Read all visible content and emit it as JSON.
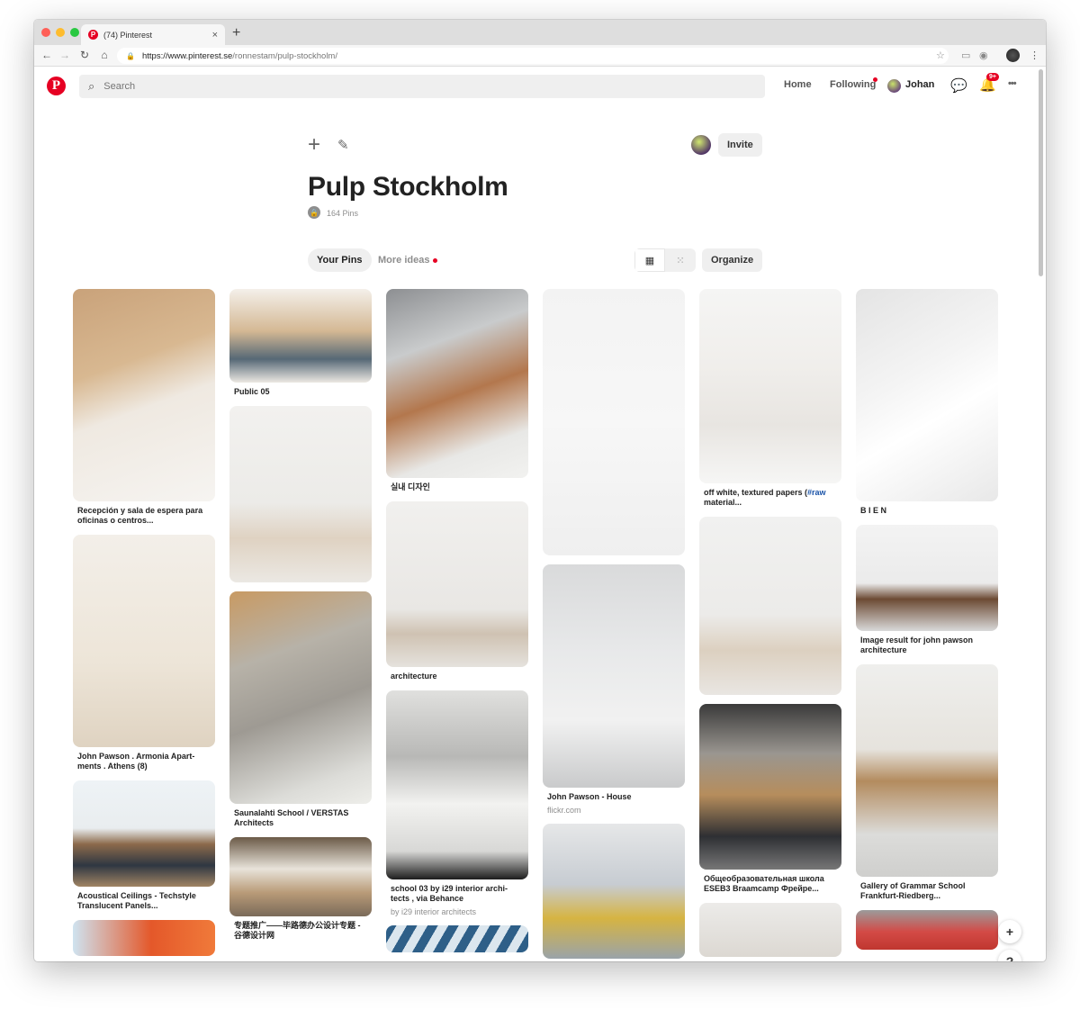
{
  "browser": {
    "tab_title": "(74) Pinterest",
    "tab_close": "×",
    "new_tab": "+",
    "url_base": "https://www.pinterest.se",
    "url_path": "/ronnestam/pulp-stockholm/",
    "back": "←",
    "forward": "→",
    "reload": "↻",
    "home": "⌂",
    "star": "☆",
    "menu": "⋮",
    "traffic_colors": [
      "#ff5f57",
      "#febc2e",
      "#28c840"
    ]
  },
  "header": {
    "logo": "P",
    "search_placeholder": "Search",
    "nav": {
      "home": "Home",
      "following": "Following",
      "user": "Johan"
    },
    "notif_badge": "9+",
    "more": "•••"
  },
  "board": {
    "title": "Pulp Stockholm",
    "pin_count": "164 Pins",
    "invite": "Invite",
    "tabs": {
      "your_pins": "Your Pins",
      "more_ideas": "More ideas"
    },
    "organize": "Organize"
  },
  "columns": [
    [
      {
        "caption": "Recepción y sala de espera para oficinas o centros...",
        "source": "",
        "h": 236,
        "bg": "linear-gradient(160deg,#c9a27a 0%,#d8b891 35%,#efe9e1 55%,#f6f4f1 100%)"
      },
      {
        "caption": "John Pawson . Armonia Apart-ments . Athens (8)",
        "source": "",
        "h": 236,
        "bg": "linear-gradient(180deg,#f3efe9 0%,#ede5d8 60%,#dfd3c1 100%)"
      },
      {
        "caption": "Acoustical Ceilings - Techstyle Translucent Panels...",
        "source": "",
        "h": 118,
        "bg": "linear-gradient(180deg,#eef3f6 0%,#e9edef 45%,#8c6a4b 60%,#2f3742 80%,#a08463 100%)"
      },
      {
        "caption": "",
        "source": "",
        "h": 40,
        "bg": "linear-gradient(90deg,#cfe3f0 0%,#e4582a 55%,#f07a3a 100%)"
      }
    ],
    [
      {
        "caption": "Public 05",
        "source": "",
        "h": 104,
        "bg": "linear-gradient(180deg,#f4f0ea 0%,#d4b894 45%,#566876 75%,#ece8e2 100%)"
      },
      {
        "caption": "",
        "source": "",
        "h": 196,
        "bg": "linear-gradient(180deg,#f2f1ef 0%,#ecebe8 55%,#dfd2c2 75%,#ebe8e3 100%)"
      },
      {
        "caption": "Saunalahti School / VERSTAS Architects",
        "source": "",
        "h": 236,
        "bg": "linear-gradient(160deg,#c89a63 0%,#b7b2a8 30%,#9e9a93 55%,#dcdcd8 85%,#eeeeea 100%)"
      },
      {
        "caption": "专题推广——毕路德办公设计专题 - 谷德设计网",
        "source": "",
        "h": 88,
        "bg": "linear-gradient(180deg,#6b5a47 0%,#e8e3da 40%,#b99b78 70%,#7a6a59 100%)"
      }
    ],
    [
      {
        "caption": "실내 디자인",
        "source": "",
        "h": 210,
        "bg": "linear-gradient(160deg,#8d8f92 0%,#c9cbcc 30%,#b3774d 55%,#e8e8e6 80%,#f2f2f0 100%)"
      },
      {
        "caption": "architecture",
        "source": "",
        "h": 184,
        "bg": "linear-gradient(180deg,#f1f0ee 0%,#e9e7e4 65%,#cfc2b2 80%,#e5e2dd 100%)"
      },
      {
        "caption": "school 03 by i29 interior archi-tects , via Behance",
        "source": "by i29 interior architects",
        "h": 210,
        "bg": "linear-gradient(180deg,#e0e0de 0%,#b8b8b6 35%,#f2f2f0 60%,#d8d8d6 85%,#1d1d1d 100%)"
      },
      {
        "caption": "",
        "source": "",
        "h": 30,
        "bg": "repeating-linear-gradient(120deg,#2e5f88 0 10px,#dbe6ee 10px 20px)"
      }
    ],
    [
      {
        "caption": "",
        "source": "",
        "h": 296,
        "bg": "linear-gradient(180deg,#f3f3f3 0%,#f7f7f7 50%,#efefef 100%)"
      },
      {
        "caption": "John Pawson - House",
        "source": "flickr.com",
        "h": 248,
        "bg": "linear-gradient(180deg,#d9dadb 0%,#e8e9ea 40%,#f1f1f1 70%,#c9cacb 100%)"
      },
      {
        "caption": "",
        "source": "",
        "h": 150,
        "bg": "linear-gradient(180deg,#e6e7e8 0%,#c7ccd2 45%,#d6b442 70%,#9aa3a9 100%)"
      }
    ],
    [
      {
        "caption": "off white, textured papers (",
        "caption_hl": "#raw",
        "caption_tail": " material...",
        "source": "",
        "h": 216,
        "bg": "linear-gradient(180deg,#f5f5f4 0%,#f0eeeb 40%,#e8e5e1 70%,#f6f6f5 100%)"
      },
      {
        "caption": "",
        "source": "",
        "h": 198,
        "bg": "linear-gradient(180deg,#f1f1f0 0%,#ecebe9 55%,#dcd0c0 75%,#e9e6e2 100%)"
      },
      {
        "caption": "Общеобразовательная школа ESEB3 Braamcamp Фрейре...",
        "source": "",
        "h": 184,
        "bg": "linear-gradient(180deg,#3a3a3a 0%,#9a9690 30%,#b68d5c 55%,#2e2f33 80%,#777 100%)"
      },
      {
        "caption": "",
        "source": "",
        "h": 60,
        "bg": "linear-gradient(180deg,#ecebe9 0%,#dcd8d2 100%)"
      }
    ],
    [
      {
        "caption": "B I E N",
        "source": "",
        "h": 236,
        "bg": "linear-gradient(150deg,#e4e4e4 0%,#f4f4f4 40%,#ffffff 60%,#e8e8e8 100%)"
      },
      {
        "caption": "Image result for john pawson architecture",
        "source": "",
        "h": 118,
        "bg": "linear-gradient(180deg,#f3f3f3 0%,#ebebeb 55%,#6c4a33 70%,#d9d9d9 100%)"
      },
      {
        "caption": "Gallery of Grammar School Frankfurt-Riedberg...",
        "source": "",
        "h": 236,
        "bg": "linear-gradient(180deg,#efefed 0%,#e6e3dd 40%,#b38b5e 55%,#dcdcda 80%,#cfcfcd 100%)"
      },
      {
        "caption": "",
        "source": "",
        "h": 44,
        "bg": "linear-gradient(180deg,#9b9b9b 0%,#d34a46 55%,#c0372f 100%)"
      }
    ]
  ],
  "float_buttons": {
    "add": "+",
    "help": "?"
  }
}
